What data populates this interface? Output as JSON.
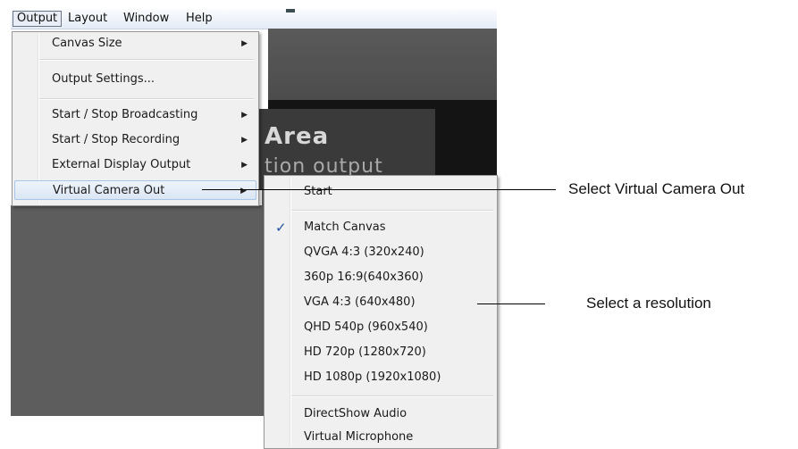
{
  "menubar": {
    "items": [
      {
        "label": "Output"
      },
      {
        "label": "Layout"
      },
      {
        "label": "Window"
      },
      {
        "label": "Help"
      }
    ]
  },
  "preview": {
    "title": "Area",
    "subtitle": "tion output"
  },
  "output_menu": {
    "items": [
      {
        "label": "Canvas Size",
        "has_submenu": true
      },
      {
        "label": "Output Settings..."
      },
      {
        "label": "Start / Stop Broadcasting",
        "has_submenu": true
      },
      {
        "label": "Start / Stop Recording",
        "has_submenu": true
      },
      {
        "label": "External Display Output",
        "has_submenu": true
      },
      {
        "label": "Virtual Camera Out",
        "has_submenu": true,
        "highlighted": true
      }
    ]
  },
  "virtual_camera_submenu": {
    "items": [
      {
        "label": "Start"
      },
      {
        "label": "Match Canvas",
        "checked": true
      },
      {
        "label": "QVGA 4:3 (320x240)"
      },
      {
        "label": "360p 16:9(640x360)"
      },
      {
        "label": "VGA 4:3 (640x480)"
      },
      {
        "label": "QHD 540p (960x540)"
      },
      {
        "label": "HD 720p (1280x720)"
      },
      {
        "label": "HD 1080p (1920x1080)"
      },
      {
        "label": "DirectShow Audio"
      },
      {
        "label": "Virtual Microphone"
      }
    ]
  },
  "callouts": {
    "virtual_camera": "Select Virtual Camera Out",
    "resolution": "Select a resolution"
  },
  "icons": {
    "submenu_arrow": "▶",
    "checkmark": "✓"
  },
  "colors": {
    "menu_background": "#f0f0f0",
    "highlight_border": "#a8c4e6",
    "checkmark": "#1e4f9e"
  }
}
